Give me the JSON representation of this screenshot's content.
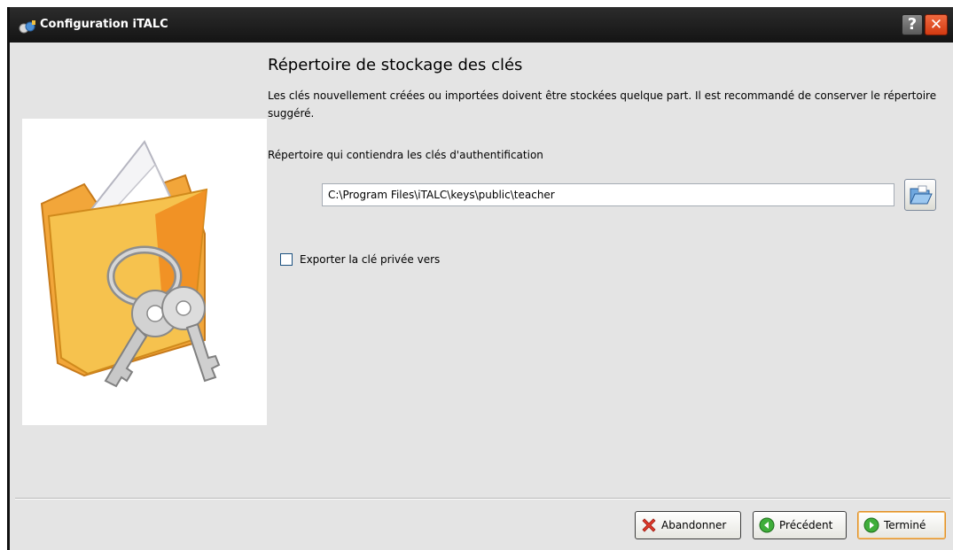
{
  "window": {
    "title": "Configuration iTALC",
    "help_symbol": "?",
    "close_symbol": "✕"
  },
  "page": {
    "title": "Répertoire de stockage des clés",
    "description": "Les clés nouvellement créées ou importées doivent être stockées quelque part. Il est recommandé de conserver le répertoire suggéré."
  },
  "directory": {
    "label": "Répertoire qui contiendra les clés d'authentification",
    "value": "C:\\Program Files\\iTALC\\keys\\public\\teacher"
  },
  "export_private": {
    "label": "Exporter la clé privée vers",
    "checked": false
  },
  "buttons": {
    "cancel": "Abandonner",
    "previous": "Précédent",
    "finish": "Terminé"
  },
  "icons": {
    "app": "italc-app-icon",
    "side": "folder-keys-icon",
    "browse": "open-folder-icon",
    "cancel": "red-x-icon",
    "previous": "green-left-arrow-icon",
    "finish": "green-right-arrow-icon"
  },
  "colors": {
    "titlebar": "#1e1e1e",
    "close_button": "#e04a1f",
    "finish_border": "#e0902a",
    "dialog_bg": "#e4e4e4"
  }
}
